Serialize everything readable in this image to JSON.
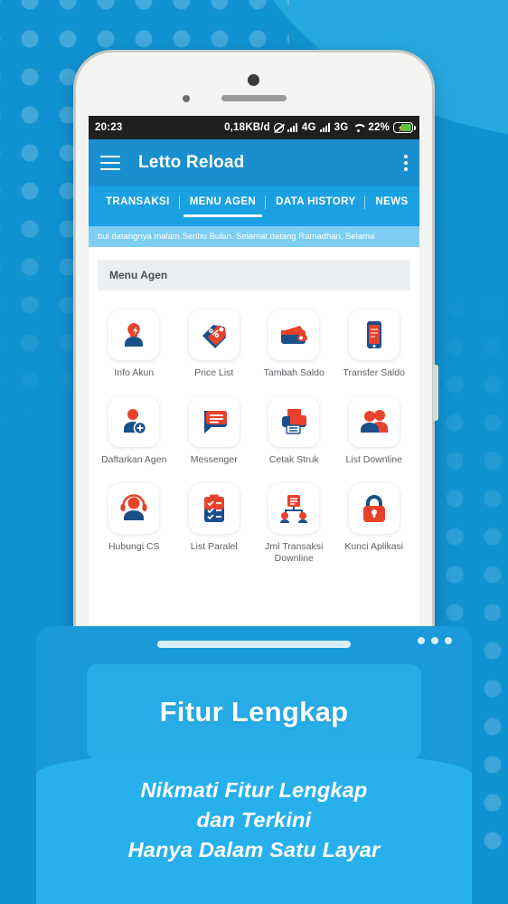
{
  "statusbar": {
    "time": "20:23",
    "data_rate": "0,18KB/d",
    "network_1": "4G",
    "network_2": "3G",
    "battery_percent": "22%",
    "alarm_icon": "alarm-off-icon",
    "wifi_icon": "wifi-icon",
    "battery_icon": "battery-charging-icon"
  },
  "toolbar": {
    "menu_icon": "hamburger-icon",
    "title": "Letto Reload",
    "overflow_icon": "kebab-menu-icon"
  },
  "tabs": [
    {
      "label": "TRANSAKSI",
      "active": false
    },
    {
      "label": "MENU AGEN",
      "active": true
    },
    {
      "label": "DATA HISTORY",
      "active": false
    },
    {
      "label": "NEWS",
      "active": false
    }
  ],
  "ticker": {
    "text": "bul datangnya malam Seribu Bulan. Selamat datang Ramadhan, Selama"
  },
  "section": {
    "title": "Menu Agen"
  },
  "menu_items": [
    {
      "label": "Info Akun",
      "icon": "user-profile-icon"
    },
    {
      "label": "Price List",
      "icon": "price-tag-icon"
    },
    {
      "label": "Tambah Saldo",
      "icon": "wallet-icon"
    },
    {
      "label": "Transfer Saldo",
      "icon": "mobile-phone-icon"
    },
    {
      "label": "Daftarkan Agen",
      "icon": "user-add-icon"
    },
    {
      "label": "Messenger",
      "icon": "chat-bubble-icon"
    },
    {
      "label": "Cetak Struk",
      "icon": "printer-icon"
    },
    {
      "label": "List Downline",
      "icon": "group-users-icon"
    },
    {
      "label": "Hubungi CS",
      "icon": "headset-support-icon"
    },
    {
      "label": "List Paralel",
      "icon": "clipboard-checklist-icon"
    },
    {
      "label": "Jml Transaksi Downline",
      "icon": "network-tree-icon"
    },
    {
      "label": "Kunci Aplikasi",
      "icon": "padlock-icon"
    }
  ],
  "promo": {
    "hero_title": "Fitur Lengkap",
    "tagline_line1": "Nikmati Fitur Lengkap",
    "tagline_line2": "dan Terkini",
    "tagline_line3": "Hanya Dalam Satu Layar",
    "window_bar_icon": "window-bar-icon",
    "window_dots_icon": "window-dots-icon"
  },
  "colors": {
    "background_blue": "#1193d2",
    "background_blue_light": "#27a9e0",
    "toolbar_blue": "#1a8fd0",
    "tabs_blue": "#1ba0e2",
    "ticker_blue": "#7ecef4",
    "panel_blue": "#1a9ad8",
    "panel_wave_blue": "#28b0ec",
    "icon_red": "#e8412c",
    "icon_navy": "#1b4f8a"
  }
}
